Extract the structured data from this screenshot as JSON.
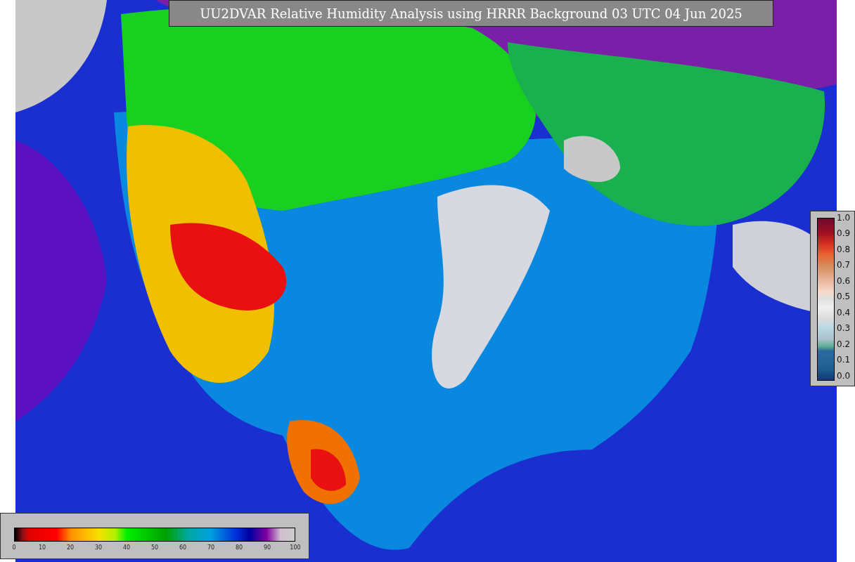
{
  "title": "UU2DVAR Relative Humidity Analysis using HRRR Background 03 UTC 04 Jun 2025",
  "humidity_colorbar": {
    "ticks": [
      "0",
      "10",
      "20",
      "30",
      "40",
      "50",
      "60",
      "70",
      "80",
      "90",
      "100"
    ]
  },
  "observation_colorbar": {
    "ticks": [
      "1.0",
      "0.9",
      "0.8",
      "0.7",
      "0.6",
      "0.5",
      "0.4",
      "0.3",
      "0.2",
      "0.1",
      "0.0"
    ]
  }
}
